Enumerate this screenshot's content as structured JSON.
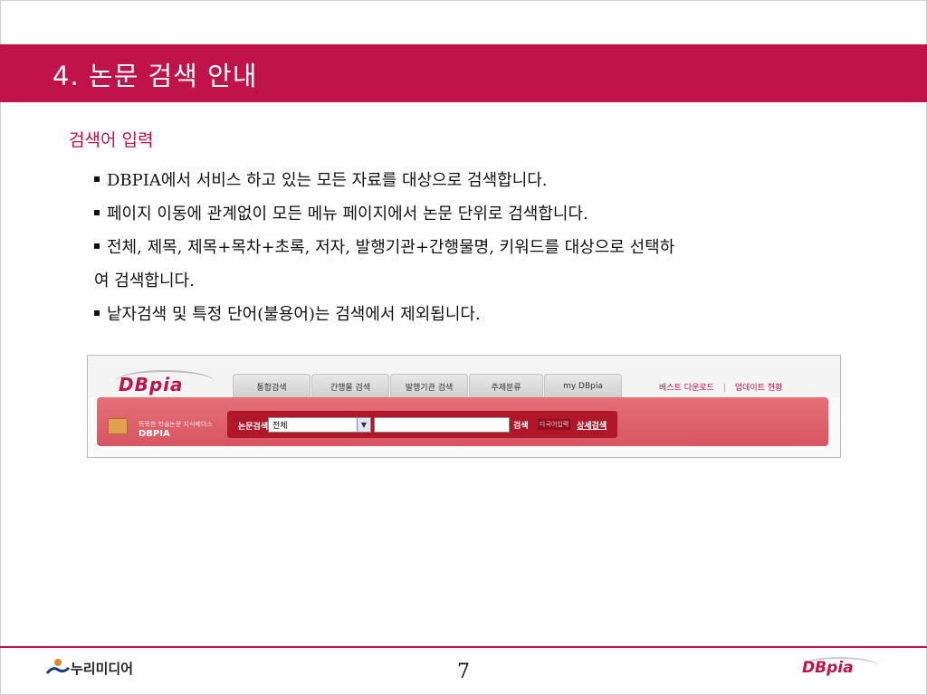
{
  "slide": {
    "title": "4. 논문 검색 안내",
    "subheading": "검색어 입력",
    "bullets": [
      "DBPIA에서 서비스 하고 있는 모든 자료를 대상으로 검색합니다.",
      "페이지 이동에 관계없이 모든 메뉴 페이지에서 논문 단위로 검색합니다.",
      "전체, 제목, 제목+목차+초록, 저자, 발행기관+간행물명, 키워드를 대상으로 선택하",
      "여 검색합니다.",
      "낱자검색 및 특정 단어(불용어)는 검색에서 제외됩니다."
    ],
    "page_number": "7"
  },
  "screenshot": {
    "logo": "DBpia",
    "tabs": [
      "통합검색",
      "간행물 검색",
      "발행기관 검색",
      "주제분류",
      "my DBpia"
    ],
    "top_links": [
      "베스트 다운로드",
      "업데이트 현황"
    ],
    "tagline": "똑똑한 학술논문 지식베이스",
    "brand": "DBPIA",
    "search_label": "논문검색",
    "select_value": "전체",
    "query_value": "",
    "search_button": "검색",
    "multi_button": "다국어입력",
    "advanced_link": "상세검색"
  },
  "footer": {
    "company": "누리미디어",
    "brand": "DBpia"
  },
  "colors": {
    "accent": "#c0134a",
    "bar": "#d75562"
  }
}
